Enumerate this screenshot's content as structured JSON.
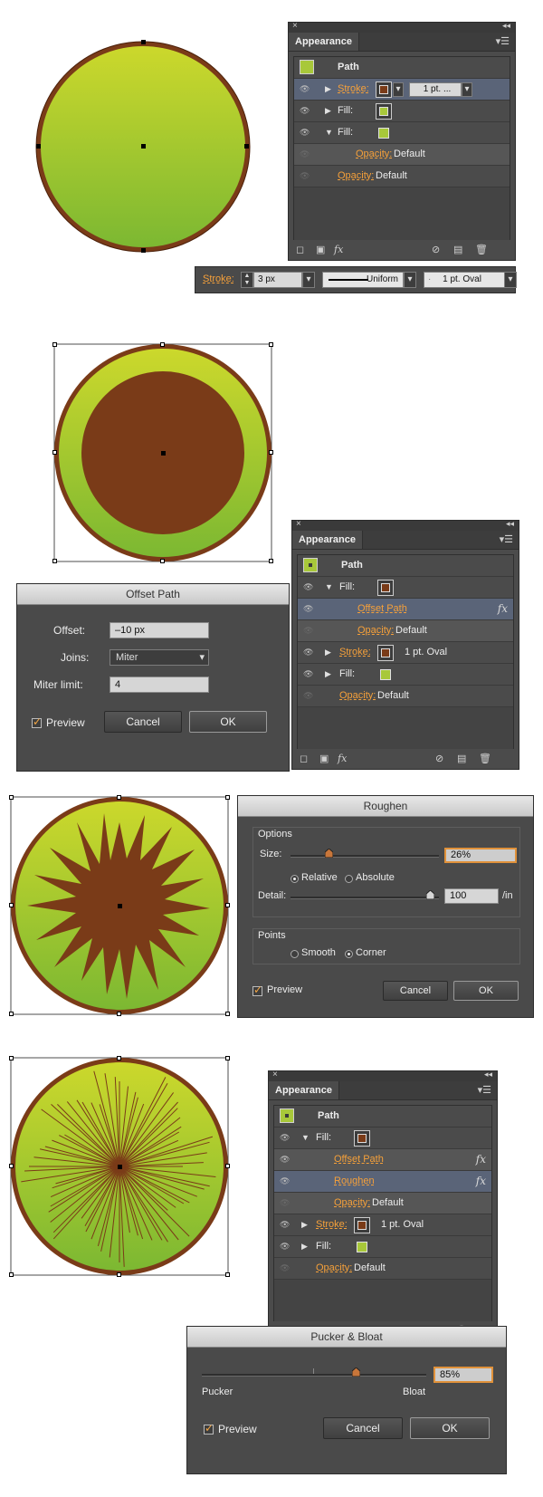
{
  "colors": {
    "lime_top": "#ccd82c",
    "lime_bottom": "#7cb832",
    "rim": "#7a3b18",
    "accent": "#f5a03a",
    "panel_bg": "#4b4b4b",
    "selection": "#5a6478"
  },
  "icons": {
    "eye": "eye-icon",
    "fx": "fx-icon",
    "close": "close-icon",
    "collapse": "double-chevron-icon",
    "panel_menu": "panel-menu-icon",
    "new_art": "new-art-icon",
    "add_stroke": "add-stroke-icon",
    "add_effect": "add-effect-icon",
    "clear": "clear-appearance-icon",
    "duplicate": "duplicate-item-icon",
    "delete": "trash-icon"
  },
  "panel1": {
    "tab": "Appearance",
    "header": "Path",
    "rows": [
      {
        "label": "Stroke:",
        "value": "1 pt. ...",
        "link": true
      },
      {
        "label": "Fill:"
      },
      {
        "label": "Fill:"
      },
      {
        "label": "Opacity:",
        "value": "Default",
        "link": true
      },
      {
        "label": "Opacity:",
        "value": "Default",
        "link": true
      }
    ],
    "fx_label": "fx"
  },
  "strokebar": {
    "label": "Stroke:",
    "weight": "3 px",
    "profile": "Uniform",
    "brush": "1 pt. Oval"
  },
  "panel2": {
    "tab": "Appearance",
    "header": "Path",
    "rows": [
      {
        "label": "Fill:"
      },
      {
        "label": "Offset Path",
        "link": true,
        "fx": "fx"
      },
      {
        "label": "Opacity:",
        "value": "Default",
        "link": true
      },
      {
        "label": "Stroke:",
        "value": "1 pt. Oval",
        "link": true
      },
      {
        "label": "Fill:"
      },
      {
        "label": "Opacity:",
        "value": "Default",
        "link": true
      }
    ],
    "fx_label": "fx"
  },
  "offset_dialog": {
    "title": "Offset Path",
    "offset_label": "Offset:",
    "offset_value": "–10 px",
    "joins_label": "Joins:",
    "joins_value": "Miter",
    "miter_label": "Miter limit:",
    "miter_value": "4",
    "preview": "Preview",
    "cancel": "Cancel",
    "ok": "OK"
  },
  "roughen_dialog": {
    "title": "Roughen",
    "options": "Options",
    "size_label": "Size:",
    "size_value": "26%",
    "size_fraction": 0.26,
    "relative": "Relative",
    "absolute": "Absolute",
    "detail_label": "Detail:",
    "detail_value": "100",
    "detail_unit": "/in",
    "points": "Points",
    "smooth": "Smooth",
    "corner": "Corner",
    "preview": "Preview",
    "cancel": "Cancel",
    "ok": "OK"
  },
  "panel3": {
    "tab": "Appearance",
    "header": "Path",
    "rows": [
      {
        "label": "Fill:"
      },
      {
        "label": "Offset Path",
        "link": true,
        "fx": "fx"
      },
      {
        "label": "Roughen",
        "link": true,
        "fx": "fx"
      },
      {
        "label": "Opacity:",
        "value": "Default",
        "link": true
      },
      {
        "label": "Stroke:",
        "value": "1 pt. Oval",
        "link": true
      },
      {
        "label": "Fill:"
      },
      {
        "label": "Opacity:",
        "value": "Default",
        "link": true
      }
    ],
    "fx_label": "fx"
  },
  "pucker_dialog": {
    "title": "Pucker & Bloat",
    "value": "85%",
    "pucker": "Pucker",
    "bloat": "Bloat",
    "preview": "Preview",
    "cancel": "Cancel",
    "ok": "OK"
  }
}
